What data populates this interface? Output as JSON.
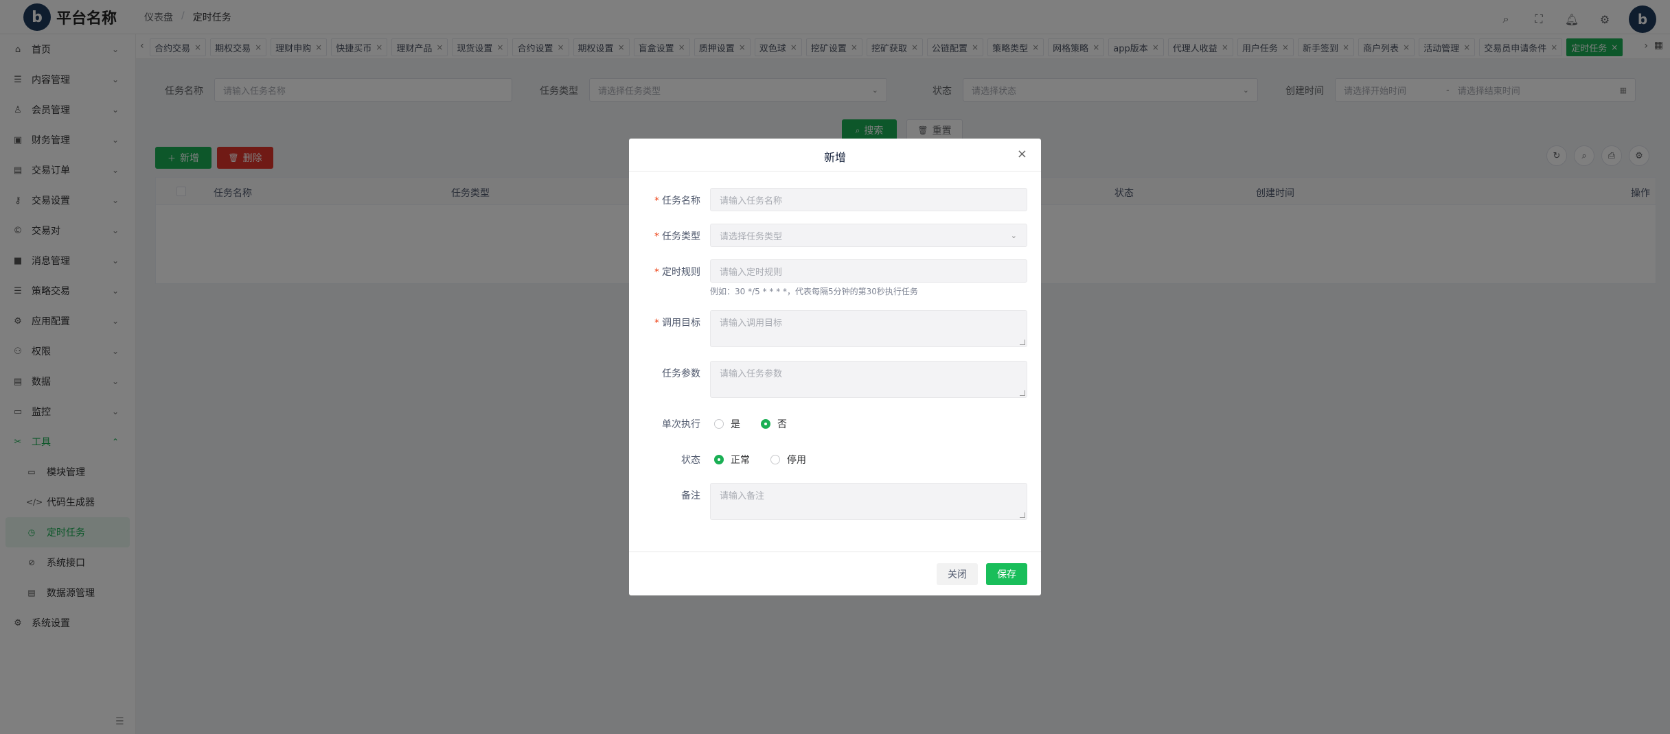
{
  "header": {
    "platform_name": "平台名称",
    "logo_text": "b",
    "breadcrumb": [
      "仪表盘",
      "定时任务"
    ],
    "avatar_text": "b"
  },
  "sidebar": {
    "items": [
      {
        "label": "首页",
        "icon": "home-icon",
        "glyph": "⌂"
      },
      {
        "label": "内容管理",
        "icon": "list-icon",
        "glyph": "☰"
      },
      {
        "label": "会员管理",
        "icon": "user-icon",
        "glyph": "♙"
      },
      {
        "label": "财务管理",
        "icon": "wallet-icon",
        "glyph": "▣"
      },
      {
        "label": "交易订单",
        "icon": "order-icon",
        "glyph": "▤"
      },
      {
        "label": "交易设置",
        "icon": "key-icon",
        "glyph": "⚷"
      },
      {
        "label": "交易对",
        "icon": "coin-icon",
        "glyph": "©"
      },
      {
        "label": "消息管理",
        "icon": "message-icon",
        "glyph": "■"
      },
      {
        "label": "策略交易",
        "icon": "strategy-icon",
        "glyph": "☰"
      },
      {
        "label": "应用配置",
        "icon": "app-config-icon",
        "glyph": "⚙"
      },
      {
        "label": "权限",
        "icon": "permission-icon",
        "glyph": "⚇"
      },
      {
        "label": "数据",
        "icon": "data-icon",
        "glyph": "▤"
      },
      {
        "label": "监控",
        "icon": "monitor-icon",
        "glyph": "▭"
      },
      {
        "label": "工具",
        "icon": "tools-icon",
        "glyph": "✂"
      }
    ],
    "tools_children": [
      {
        "label": "模块管理",
        "icon": "folder-icon",
        "glyph": "▭"
      },
      {
        "label": "代码生成器",
        "icon": "code-icon",
        "glyph": "</>"
      },
      {
        "label": "定时任务",
        "icon": "clock-icon",
        "glyph": "◷"
      },
      {
        "label": "系统接口",
        "icon": "compass-icon",
        "glyph": "⊘"
      },
      {
        "label": "数据源管理",
        "icon": "database-icon",
        "glyph": "▤"
      }
    ],
    "settings": {
      "label": "系统设置",
      "icon": "gear-icon",
      "glyph": "⚙"
    }
  },
  "tabs": [
    "合约交易",
    "期权交易",
    "理财申购",
    "快捷买币",
    "理财产品",
    "现货设置",
    "合约设置",
    "期权设置",
    "盲盒设置",
    "质押设置",
    "双色球",
    "挖矿设置",
    "挖矿获取",
    "公链配置",
    "策略类型",
    "网格策略",
    "app版本",
    "代理人收益",
    "用户任务",
    "新手签到",
    "商户列表",
    "活动管理",
    "交易员申请条件",
    "定时任务"
  ],
  "search": {
    "name_label": "任务名称",
    "name_placeholder": "请输入任务名称",
    "type_label": "任务类型",
    "type_placeholder": "请选择任务类型",
    "status_label": "状态",
    "status_placeholder": "请选择状态",
    "time_label": "创建时间",
    "start_placeholder": "请选择开始时间",
    "end_placeholder": "请选择结束时间",
    "search_btn": "搜索",
    "reset_btn": "重置"
  },
  "toolbar": {
    "add": "新增",
    "delete": "删除"
  },
  "table": {
    "columns": [
      "任务名称",
      "任务类型",
      "状态",
      "创建时间",
      "操作"
    ]
  },
  "modal": {
    "title": "新增",
    "name_label": "任务名称",
    "name_placeholder": "请输入任务名称",
    "type_label": "任务类型",
    "type_placeholder": "请选择任务类型",
    "cron_label": "定时规则",
    "cron_placeholder": "请输入定时规则",
    "cron_help": "例如：30 */5 * * * *，代表每隔5分钟的第30秒执行任务",
    "target_label": "调用目标",
    "target_placeholder": "请输入调用目标",
    "params_label": "任务参数",
    "params_placeholder": "请输入任务参数",
    "once_label": "单次执行",
    "once_yes": "是",
    "once_no": "否",
    "status_label": "状态",
    "status_normal": "正常",
    "status_disabled": "停用",
    "remark_label": "备注",
    "remark_placeholder": "请输入备注",
    "cancel": "关闭",
    "save": "保存"
  },
  "colors": {
    "accent": "#1aaf54",
    "danger": "#e0342b",
    "required": "#ed4014"
  }
}
